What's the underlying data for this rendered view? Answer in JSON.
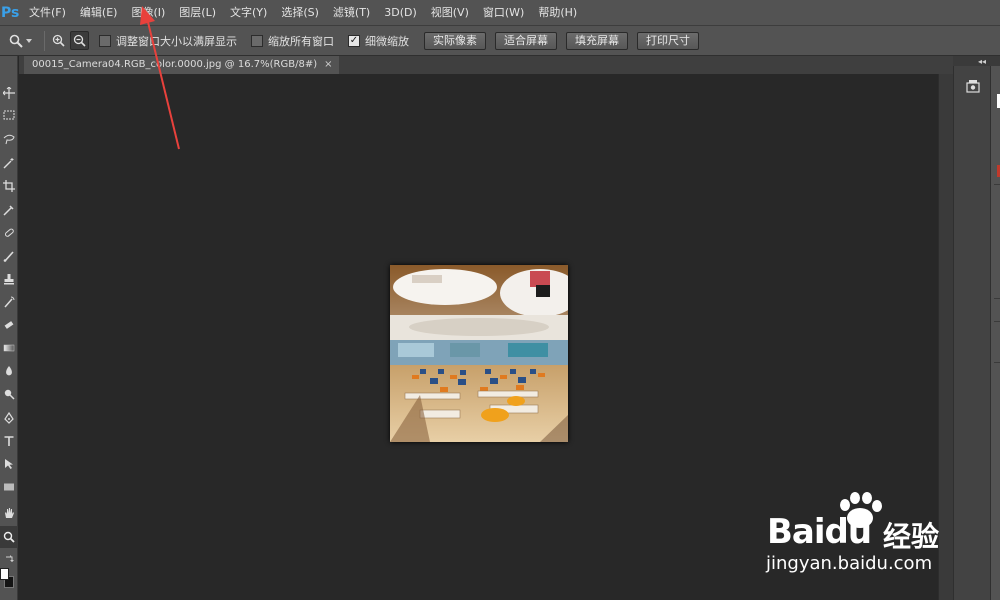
{
  "menubar": {
    "logo": "Ps",
    "items": [
      "文件(F)",
      "编辑(E)",
      "图像(I)",
      "图层(L)",
      "文字(Y)",
      "选择(S)",
      "滤镜(T)",
      "3D(D)",
      "视图(V)",
      "窗口(W)",
      "帮助(H)"
    ]
  },
  "options": {
    "resize_windows_label": "调整窗口大小以满屏显示",
    "resize_windows_checked": false,
    "zoom_all_label": "缩放所有窗口",
    "zoom_all_checked": false,
    "scrubby_label": "细微缩放",
    "scrubby_checked": true,
    "actual_pixels": "实际像素",
    "fit_screen": "适合屏幕",
    "fill_screen": "填充屏幕",
    "print_size": "打印尺寸"
  },
  "document": {
    "tab_title": "00015_Camera04.RGB_color.0000.jpg @ 16.7%(RGB/8#)",
    "tab_close": "×"
  },
  "watermark": {
    "brand_bai": "Bai",
    "brand_du": "du",
    "brand_cn": "经验",
    "url": "jingyan.baidu.com"
  },
  "colors": {
    "app_bg": "#282828",
    "panel": "#535353",
    "annotation_arrow": "#e8413c"
  }
}
